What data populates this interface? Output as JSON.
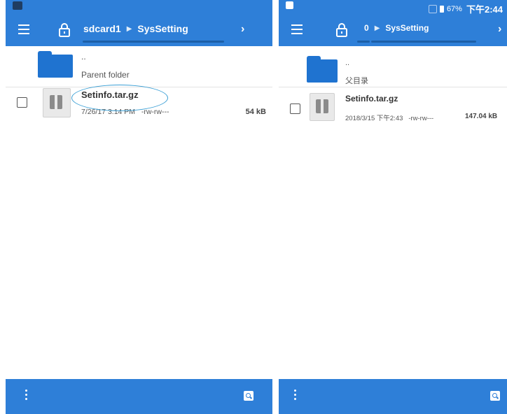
{
  "left": {
    "breadcrumbs": [
      "sdcard1",
      "SysSetting"
    ],
    "parent_dots": "..",
    "parent_label": "Parent folder",
    "file": {
      "name": "Setinfo.tar.gz",
      "datetime": "7/26/17 3:14 PM",
      "permissions": "-rw-rw---",
      "size": "54 kB"
    }
  },
  "right": {
    "status": {
      "battery": "67%",
      "time": "下午2:44"
    },
    "breadcrumbs": [
      "0",
      "SysSetting"
    ],
    "parent_dots": "..",
    "parent_label": "父目录",
    "file": {
      "name": "Setinfo.tar.gz",
      "datetime": "2018/3/15 下午2:43",
      "permissions": "-rw-rw---",
      "size": "147.04 kB"
    }
  },
  "colors": {
    "toolbar": "#2e7fd8",
    "folder": "#1f73d0",
    "highlight": "#3a9fd5"
  },
  "icons": [
    "menu-icon",
    "lock-icon",
    "chevron-right-icon",
    "folder-icon",
    "archive-icon",
    "overflow-menu-icon",
    "search-icon"
  ]
}
